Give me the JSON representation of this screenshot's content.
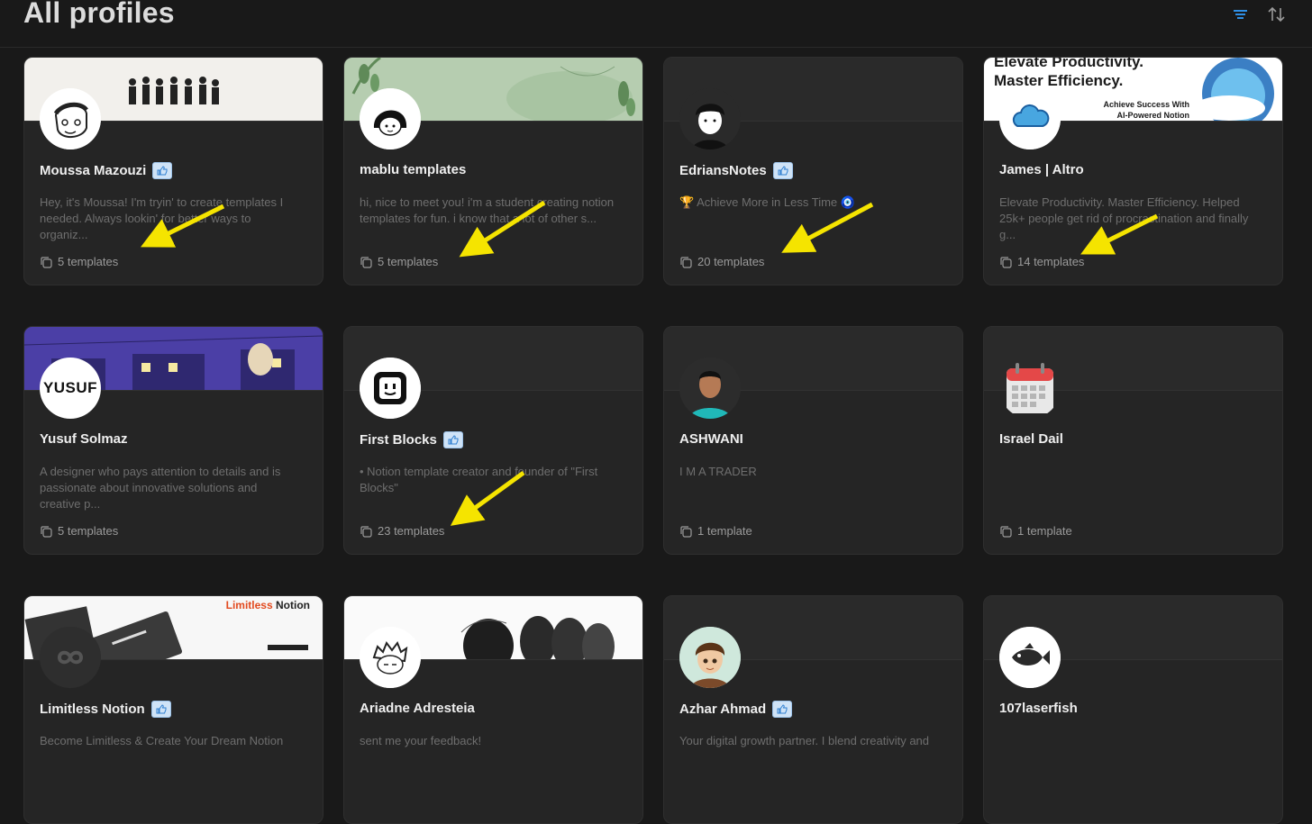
{
  "header": {
    "title": "All profiles",
    "filter_icon": "filter-lines-icon",
    "sort_icon": "sort-arrows-icon",
    "accent": "#2f8fe5"
  },
  "profiles": [
    {
      "name": "Moussa Mazouzi",
      "verified": true,
      "description": "Hey, it's Moussa! I'm tryin' to create templates I needed. Always lookin' for better ways to organiz...",
      "templates": "5 templates",
      "avatar": "sketch-face-avatar"
    },
    {
      "name": "mablu templates",
      "verified": false,
      "description": "hi, nice to meet you! i'm a student creating notion templates for fun. i know that a lot of other s...",
      "templates": "5 templates",
      "avatar": "bob-haircut-avatar"
    },
    {
      "name": "EdriansNotes",
      "verified": true,
      "description": "🏆 Achieve More in Less Time 🧿",
      "templates": "20 templates",
      "avatar": "dark-hair-avatar"
    },
    {
      "name": "James | Altro",
      "verified": false,
      "description": "Elevate Productivity. Master Efficiency. Helped 25k+ people get rid of procrastination and finally g...",
      "templates": "14 templates",
      "avatar": "cloud-logo-avatar",
      "cover_line1": "Elevate Productivity.",
      "cover_line2": "Master Efficiency.",
      "cover_line3": "Achieve Success With",
      "cover_line4": "AI-Powered Notion Templates."
    },
    {
      "name": "Yusuf Solmaz",
      "verified": false,
      "description": "A designer who pays attention to details and is passionate about innovative solutions and creative p...",
      "templates": "5 templates",
      "avatar": "yusuf-wordmark-avatar",
      "avatar_text": "YUSUF"
    },
    {
      "name": "First Blocks",
      "verified": true,
      "description": "• Notion template creator and founder of \"First Blocks\"",
      "templates": "23 templates",
      "avatar": "block-face-avatar"
    },
    {
      "name": "ASHWANI",
      "verified": false,
      "description": "I M A TRADER",
      "templates": "1 template",
      "avatar": "photo-avatar"
    },
    {
      "name": "Israel Dail",
      "verified": false,
      "description": "",
      "templates": "1 template",
      "avatar": "calendar-avatar"
    },
    {
      "name": "Limitless Notion",
      "verified": true,
      "description": "Become Limitless & Create Your Dream Notion",
      "templates": "",
      "avatar": "infinity-avatar",
      "cover_brand_a": "Limitless",
      "cover_brand_b": "Notion"
    },
    {
      "name": "Ariadne Adresteia",
      "verified": false,
      "description": "sent me your feedback!",
      "templates": "",
      "avatar": "anime-face-avatar"
    },
    {
      "name": "Azhar Ahmad",
      "verified": true,
      "description": "Your digital growth partner. I blend creativity and",
      "templates": "",
      "avatar": "cartoon-boy-avatar"
    },
    {
      "name": "107laserfish",
      "verified": false,
      "description": "",
      "templates": "",
      "avatar": "fish-avatar"
    }
  ],
  "annotation_color": "#f5e400"
}
